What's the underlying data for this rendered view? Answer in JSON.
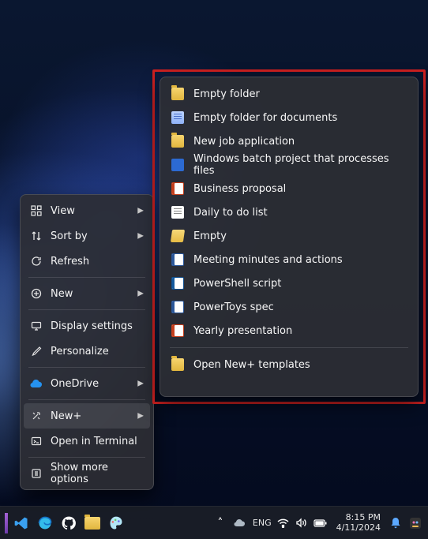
{
  "context_menu": {
    "items": [
      {
        "label": "View",
        "icon": "view-grid-icon",
        "sub": true
      },
      {
        "label": "Sort by",
        "icon": "sort-icon",
        "sub": true
      },
      {
        "label": "Refresh",
        "icon": "refresh-icon",
        "sub": false
      },
      {
        "label": "New",
        "icon": "new-icon",
        "sub": true
      },
      {
        "label": "Display settings",
        "icon": "display-icon",
        "sub": false
      },
      {
        "label": "Personalize",
        "icon": "personalize-icon",
        "sub": false
      },
      {
        "label": "OneDrive",
        "icon": "onedrive-icon",
        "sub": true
      },
      {
        "label": "New+",
        "icon": "newplus-icon",
        "sub": true
      },
      {
        "label": "Open in Terminal",
        "icon": "terminal-icon",
        "sub": false
      },
      {
        "label": "Show more options",
        "icon": "more-icon",
        "sub": false
      }
    ]
  },
  "newplus_submenu": {
    "open_templates_label": "Open New+ templates",
    "items": [
      {
        "label": "Empty folder",
        "icon": "folder"
      },
      {
        "label": "Empty folder for documents",
        "icon": "docblue"
      },
      {
        "label": "New job application",
        "icon": "folder"
      },
      {
        "label": "Windows batch project that processes files",
        "icon": "batch"
      },
      {
        "label": "Business proposal",
        "icon": "ppt"
      },
      {
        "label": "Daily to do list",
        "icon": "txt"
      },
      {
        "label": "Empty",
        "icon": "folderopen"
      },
      {
        "label": "Meeting minutes and actions",
        "icon": "word"
      },
      {
        "label": "PowerShell script",
        "icon": "ps"
      },
      {
        "label": "PowerToys spec",
        "icon": "word"
      },
      {
        "label": "Yearly presentation",
        "icon": "ppt"
      }
    ]
  },
  "taskbar": {
    "tray_lang": "ENG",
    "time": "8:15 PM",
    "date": "4/11/2024"
  }
}
